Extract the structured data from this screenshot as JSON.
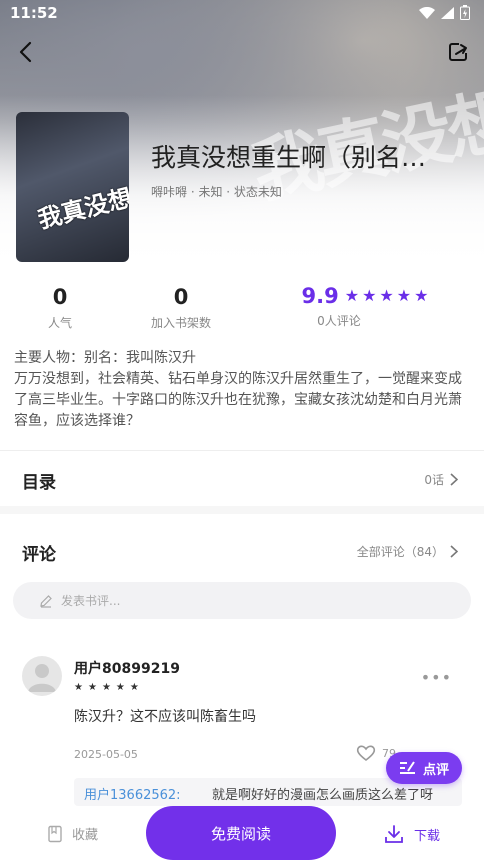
{
  "status": {
    "time": "11:52"
  },
  "book": {
    "cover_text": "我真没想重生啊",
    "title": "我真没想重生啊（别名：我叫陈汉升）",
    "meta": "嘚咔嘚 · 未知 · 状态未知"
  },
  "stats": {
    "popularity_value": "0",
    "popularity_label": "人气",
    "shelf_value": "0",
    "shelf_label": "加入书架数",
    "rating": "9.9",
    "rating_stars": 5,
    "rating_label": "0人评论"
  },
  "description": {
    "line1": "主要人物：别名：我叫陈汉升",
    "line2": "万万没想到，社会精英、钻石单身汉的陈汉升居然重生了，一觉醒来变成了高三毕业生。十字路口的陈汉升也在犹豫，宝藏女孩沈幼楚和白月光萧容鱼，应该选择谁？"
  },
  "toc": {
    "title": "目录",
    "count": "0话"
  },
  "comments": {
    "title": "评论",
    "all_label": "全部评论（84）",
    "input_placeholder": "发表书评...",
    "items": [
      {
        "user": "用户80899219",
        "stars": 5,
        "text": "陈汉升？这不应该叫陈畜生吗",
        "date": "2025-05-05",
        "likes": "79",
        "reply_user": "用户13662562:",
        "reply_text": "就是啊好好的漫画怎么画质这么差了呀"
      }
    ]
  },
  "float_button": {
    "label": "点评"
  },
  "bottom": {
    "collect_label": "收藏",
    "read_label": "免费阅读",
    "download_label": "下载"
  },
  "colors": {
    "accent": "#7230ea",
    "link": "#4a90d9"
  }
}
